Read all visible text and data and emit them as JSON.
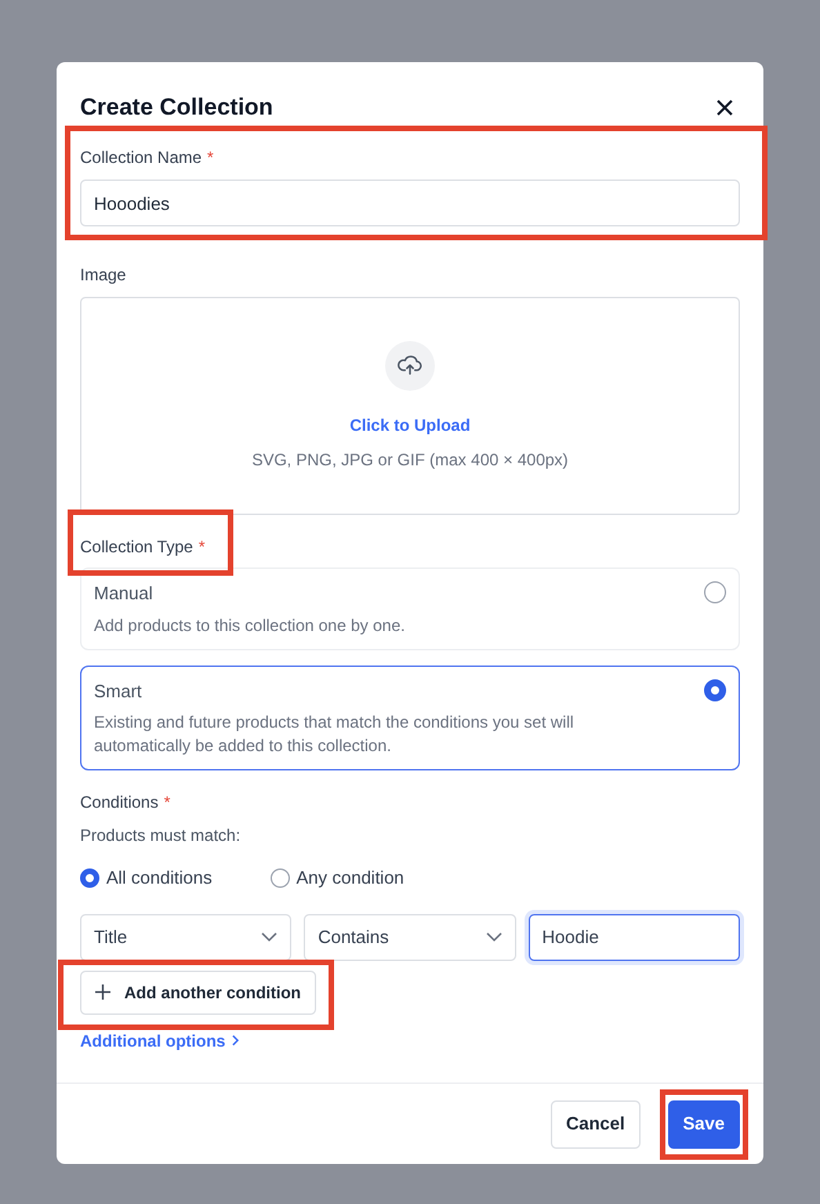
{
  "dialog": {
    "title": "Create Collection"
  },
  "name_field": {
    "label": "Collection Name",
    "required_mark": "*",
    "value": "Hooodies",
    "highlighted": true
  },
  "image": {
    "label": "Image",
    "upload_link": "Click to Upload",
    "hint": "SVG, PNG, JPG or GIF (max 400 × 400px)"
  },
  "collection_type": {
    "label": "Collection Type",
    "required_mark": "*",
    "highlighted": true,
    "options": [
      {
        "title": "Manual",
        "description": "Add products to this collection one by one.",
        "selected": false
      },
      {
        "title": "Smart",
        "description": "Existing and future products that match the conditions you set will automatically be added to this collection.",
        "selected": true
      }
    ]
  },
  "conditions": {
    "label": "Conditions",
    "required_mark": "*",
    "hint": "Products must match:",
    "match_options": [
      {
        "label": "All conditions",
        "selected": true
      },
      {
        "label": "Any condition",
        "selected": false
      }
    ],
    "rules": [
      {
        "field": "Title",
        "operator": "Contains",
        "value": "Hoodie"
      }
    ],
    "add_button": {
      "label": "Add another condition",
      "highlighted": true
    },
    "additional_options": "Additional options"
  },
  "footer": {
    "buttons": [
      {
        "label": "Cancel",
        "kind": "secondary",
        "highlighted": false
      },
      {
        "label": "Save",
        "kind": "primary",
        "highlighted": true
      }
    ]
  }
}
